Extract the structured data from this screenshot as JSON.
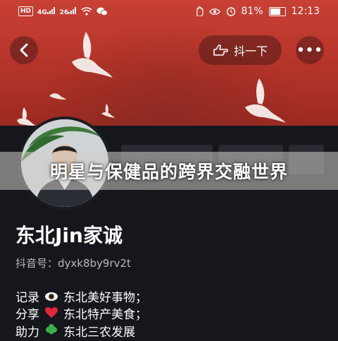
{
  "status_bar": {
    "left_icons": [
      "HD",
      "4G",
      "26",
      "wifi-icon",
      "wechat-icon"
    ],
    "right_icons": [
      "hand-icon",
      "eye-icon",
      "alarm-icon"
    ],
    "battery": "81%",
    "battery_level": 0.81,
    "time": "12:13"
  },
  "header": {
    "back_icon": "‹",
    "shake_label": "抖一下",
    "more_icon": "•••"
  },
  "headline": "明星与保健品的跨界交融世界",
  "profile": {
    "name": "东北Jin家诚",
    "douyin_id": "抖音号：dyxk8by9rv2t"
  },
  "bio": [
    {
      "prefix": "记录",
      "icon": "eye-icon",
      "text": "东北美好事物；"
    },
    {
      "prefix": "分享",
      "icon": "heart-icon",
      "text": "东北特产美食；"
    },
    {
      "prefix": "助力",
      "icon": "clover-icon",
      "text": "东北三农发展"
    }
  ],
  "colors": {
    "banner": "#b8352b",
    "background": "#16161d"
  }
}
